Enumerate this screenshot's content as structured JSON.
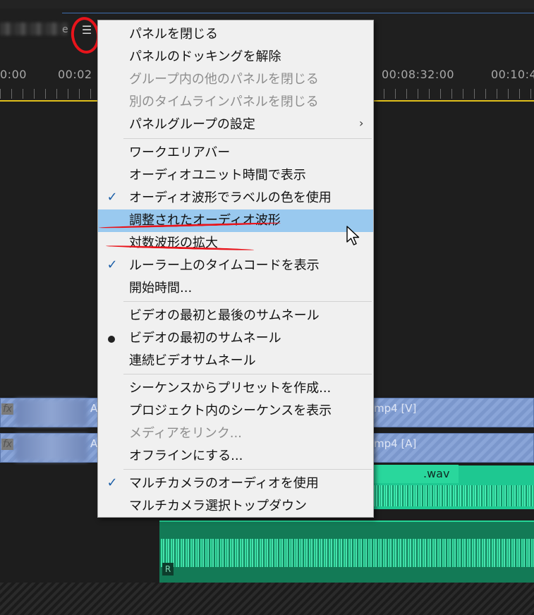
{
  "timeline": {
    "sequence_tab_suffix": "e",
    "panel_menu_icon": "hamburger-icon",
    "timecodes": [
      "0:00",
      "00:02",
      "00:08:32:00",
      "00:10:4"
    ],
    "video_clip_label": "A",
    "video_clip_right_label": "mp4 [V]",
    "audio_clip_label": "A",
    "audio_clip_right_label": "mp4 [A]",
    "fx_badge": "fx",
    "wav_label": ".wav",
    "track_badge": "R",
    "playhead_color": "#e0c01c",
    "audio_color": "#1ec891"
  },
  "menu": {
    "items": [
      {
        "label": "パネルを閉じる",
        "enabled": true
      },
      {
        "label": "パネルのドッキングを解除",
        "enabled": true
      },
      {
        "label": "グループ内の他のパネルを閉じる",
        "enabled": false
      },
      {
        "label": "別のタイムラインパネルを閉じる",
        "enabled": false
      },
      {
        "label": "パネルグループの設定",
        "enabled": true,
        "submenu": "›"
      },
      {
        "label": "ワークエリアバー",
        "enabled": true
      },
      {
        "label": "オーディオユニット時間で表示",
        "enabled": true
      },
      {
        "label": "オーディオ波形でラベルの色を使用",
        "enabled": true,
        "check": "✓"
      },
      {
        "label": "調整されたオーディオ波形",
        "enabled": true,
        "highlighted": true
      },
      {
        "label": "対数波形の拡大",
        "enabled": true
      },
      {
        "label": "ルーラー上のタイムコードを表示",
        "enabled": true,
        "check": "✓"
      },
      {
        "label": "開始時間...",
        "enabled": true
      },
      {
        "label": "ビデオの最初と最後のサムネール",
        "enabled": true
      },
      {
        "label": "ビデオの最初のサムネール",
        "enabled": true,
        "radio": true
      },
      {
        "label": "連続ビデオサムネール",
        "enabled": true
      },
      {
        "label": "シーケンスからプリセットを作成...",
        "enabled": true
      },
      {
        "label": "プロジェクト内のシーケンスを表示",
        "enabled": true
      },
      {
        "label": "メディアをリンク...",
        "enabled": false
      },
      {
        "label": "オフラインにする...",
        "enabled": true
      },
      {
        "label": "マルチカメラのオーディオを使用",
        "enabled": true,
        "check": "✓"
      },
      {
        "label": "マルチカメラ選択トップダウン",
        "enabled": true
      }
    ],
    "highlight_color": "#99c9ef",
    "annotation_color": "#e8141b"
  }
}
